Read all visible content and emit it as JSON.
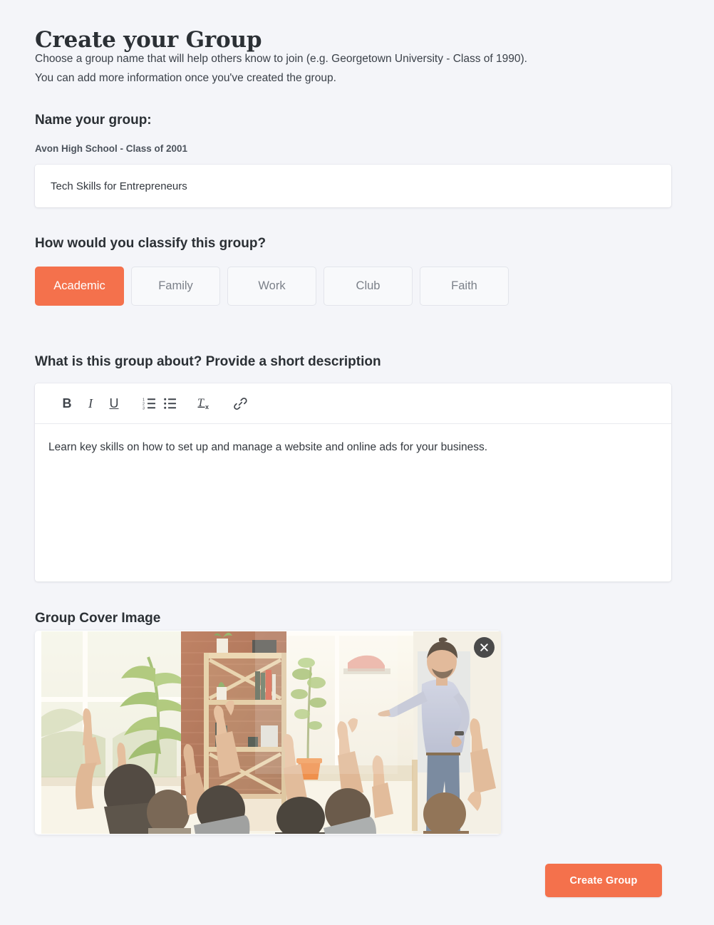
{
  "header": {
    "title": "Create your Group",
    "subtitle_line1": "Choose a group name that will help others know to join (e.g. Georgetown University - Class of 1990).",
    "subtitle_line2": "You can add more information once you've created the group."
  },
  "name_section": {
    "label": "Name your group:",
    "hint": "Avon High School - Class of 2001",
    "value": "Tech Skills for Entrepreneurs",
    "placeholder": "Avon High School - Class of 2001"
  },
  "classify_section": {
    "label": "How would you classify this group?",
    "selected": "Academic",
    "options": [
      {
        "label": "Academic",
        "selected": true
      },
      {
        "label": "Family",
        "selected": false
      },
      {
        "label": "Work",
        "selected": false
      },
      {
        "label": "Club",
        "selected": false
      },
      {
        "label": "Faith",
        "selected": false
      }
    ]
  },
  "about_section": {
    "label": "What is this group about? Provide a short description",
    "description": "Learn key skills on how to set up and manage a website and online ads for your business.",
    "toolbar": [
      {
        "name": "bold-icon",
        "label": "B"
      },
      {
        "name": "italic-icon",
        "label": "I"
      },
      {
        "name": "underline-icon",
        "label": "U"
      },
      {
        "name": "ordered-list-icon",
        "label": ""
      },
      {
        "name": "unordered-list-icon",
        "label": ""
      },
      {
        "name": "clear-formatting-icon",
        "label": ""
      },
      {
        "name": "link-icon",
        "label": ""
      }
    ]
  },
  "cover_section": {
    "label": "Group Cover Image",
    "remove_label": "Remove cover image",
    "image_alt": "Classroom with students raising hands and a presenter"
  },
  "footer": {
    "submit_label": "Create Group"
  },
  "colors": {
    "accent": "#f4714c",
    "page_background": "#f4f5f9",
    "card_background": "#ffffff",
    "text_primary": "#2b3035",
    "text_muted": "#7b8089",
    "close_button": "#4a4a4a"
  }
}
